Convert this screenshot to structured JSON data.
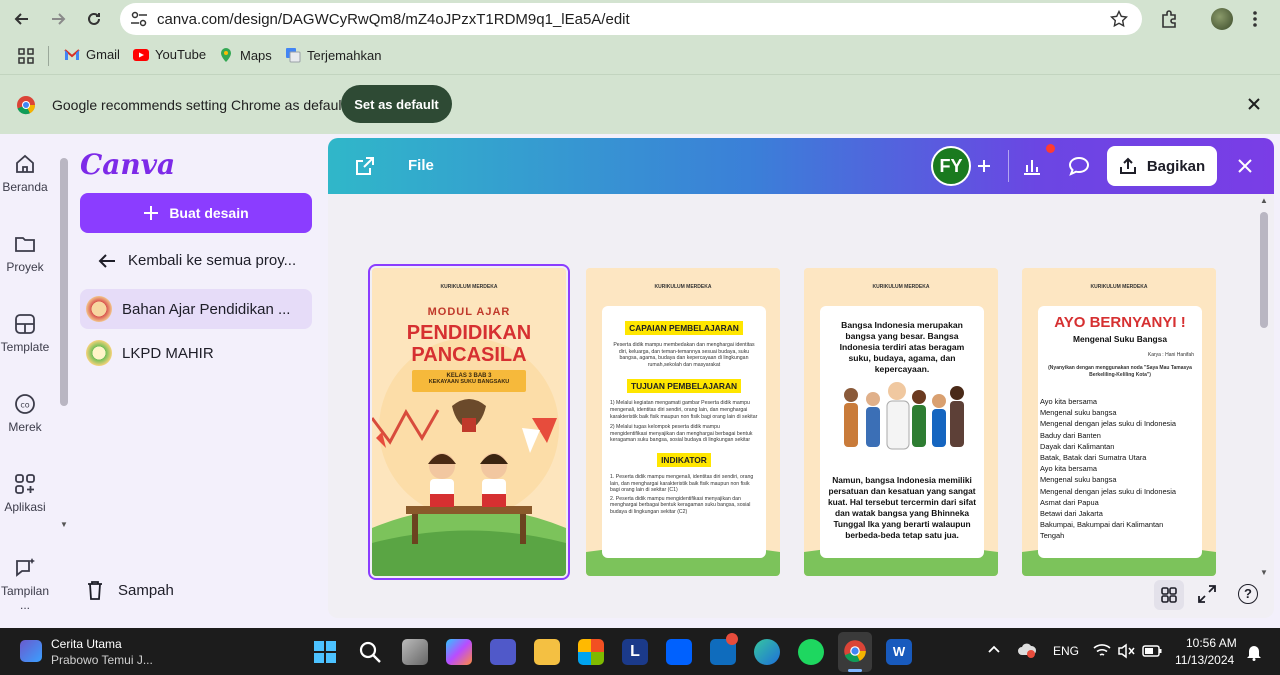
{
  "browser": {
    "url": "canva.com/design/DAGWCyRwQm8/mZ4oJPzxT1RDM9q1_lEa5A/edit",
    "bookmarks": [
      {
        "label": "Gmail"
      },
      {
        "label": "YouTube"
      },
      {
        "label": "Maps"
      },
      {
        "label": "Terjemahkan"
      }
    ],
    "infobar": {
      "message": "Google recommends setting Chrome as default",
      "button": "Set as default"
    }
  },
  "rail": {
    "items": [
      {
        "label": "Beranda",
        "icon": "home-icon"
      },
      {
        "label": "Proyek",
        "icon": "folder-icon"
      },
      {
        "label": "Template",
        "icon": "template-icon"
      },
      {
        "label": "Merek",
        "icon": "brand-icon"
      },
      {
        "label": "Aplikasi",
        "icon": "apps-icon"
      },
      {
        "label": "Tampilan ...",
        "icon": "sparkle-chat-icon"
      }
    ]
  },
  "panel": {
    "logo": "Canva",
    "create_button": "Buat desain",
    "back_label": "Kembali ke semua proy...",
    "projects": [
      {
        "label": "Bahan Ajar Pendidikan ..."
      },
      {
        "label": "LKPD MAHIR"
      }
    ],
    "trash": "Sampah"
  },
  "editor": {
    "file_label": "File",
    "avatar": "FY",
    "share_button": "Bagikan",
    "pages": [
      {
        "header": "KURIKULUM MERDEKA",
        "subtitle": "MODUL AJAR",
        "title_line1": "PENDIDIKAN",
        "title_line2": "PANCASILA",
        "ribbon_line1": "KELAS 3 BAB 3",
        "ribbon_line2": "KEKAYAAN SUKU BANGSAKU"
      },
      {
        "header": "KURIKULUM MERDEKA",
        "h1": "CAPAIAN PEMBELAJARAN",
        "p1": "Peserta didik mampu membedakan dan menghargai identitas diri, keluarga, dan teman-temannya sesuai budaya, suku bangsa, agama, budaya dan kepercayaan di lingkungan rumah,sekolah dan masyarakat",
        "h2": "TUJUAN PEMBELAJARAN",
        "p2a": "1) Melalui kegiatan mengamati gambar Peserta didik mampu mengenali, identitas diri sendiri, orang lain, dan menghargai karakteristik baik fisik maupun non fisik bagi orang lain di sekitar",
        "p2b": "2) Melalui tugas kelompok peserta didik mampu mengidentifikasi menyajikan dan menghargai berbagai bentuk keragaman suku bangsa, sosial budaya di lingkungan sekitar",
        "h3": "INDIKATOR",
        "p3a": "1. Peserta didik mampu mengenali, identitas diri sendiri, orang lain, dan menghargai karakteristik baik fisik maupun non fisik bagi orang lain di sekitar (C1)",
        "p3b": "2. Peserta didik mampu mengidentifikasi menyajikan dan menghargai berbagai bentuk keragaman suku bangsa, sosial budaya di lingkungan sekitar (C2)"
      },
      {
        "header": "KURIKULUM MERDEKA",
        "top_text": "Bangsa Indonesia merupakan bangsa yang besar. Bangsa Indonesia terdiri atas beragam suku, budaya, agama, dan kepercayaan.",
        "bottom_text": "Namun, bangsa Indonesia memiliki persatuan dan kesatuan yang sangat kuat. Hal tersebut tercermin dari sifat dan watak bangsa yang Bhinneka Tunggal Ika yang berarti walaupun berbeda-beda tetap satu jua."
      },
      {
        "header": "KURIKULUM MERDEKA",
        "title": "AYO BERNYANYI !",
        "subtitle": "Mengenal Suku Bangsa",
        "author": "Karya : Hani Hanifah",
        "note": "(Nyanyikan dengan menggunakan noda \"Saya Mau Tamasya Berkeliling-Keliling Kota\")",
        "lyrics": [
          "Ayo kita bersama",
          "Mengenal suku bangsa",
          "Mengenal dengan jelas suku di Indonesia",
          "Baduy dari Banten",
          "Dayak dari Kalimantan",
          "Batak, Batak dari Sumatra Utara",
          "Ayo kita bersama",
          "Mengenal suku bangsa",
          "Mengenal dengan jelas suku di Indonesia",
          "Asmat dari Papua",
          "Betawi dari Jakarta",
          "Bakumpai, Bakumpai dari Kalimantan",
          "Tengah"
        ]
      }
    ]
  },
  "taskbar": {
    "news_title": "Cerita Utama",
    "news_sub": "Prabowo Temui J...",
    "lang": "ENG",
    "time": "10:56 AM",
    "date": "11/13/2024"
  }
}
